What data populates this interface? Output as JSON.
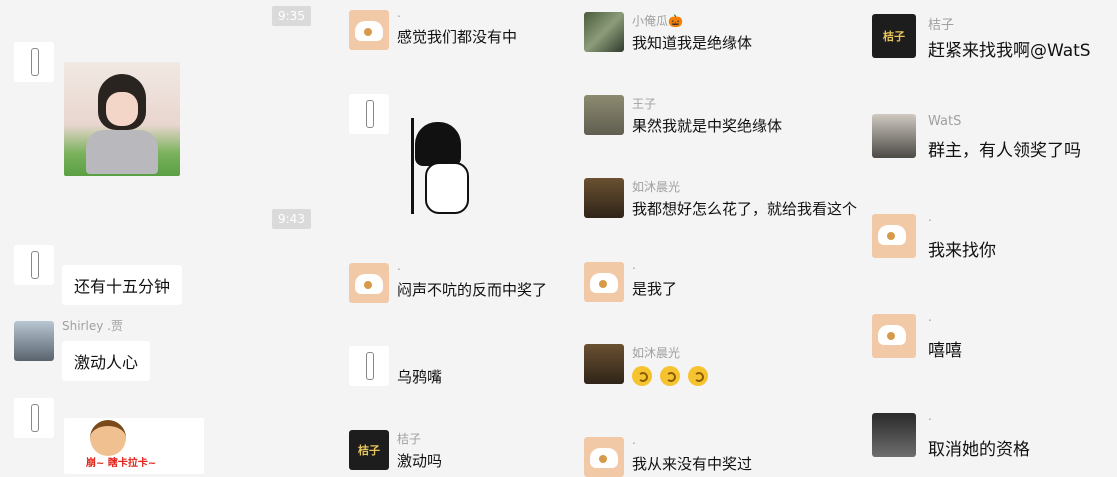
{
  "timestamps": [
    "9:35",
    "9:43"
  ],
  "col1": {
    "msg1": {
      "name": "",
      "sticker": "photo-sticker-girl"
    },
    "msg2": {
      "name": "",
      "text": "还有十五分钟"
    },
    "msg3": {
      "name": "Shirley .贾",
      "text": "激动人心"
    },
    "msg4": {
      "name": "",
      "sticker_text": "崩~ 瞎卡拉卡~"
    }
  },
  "col2": {
    "msg1": {
      "name": ".",
      "text": "感觉我们都没有中"
    },
    "msg2": {
      "name": "",
      "sticker": "peeking-cartoon"
    },
    "msg3": {
      "name": ".",
      "text": "闷声不吭的反而中奖了"
    },
    "msg4": {
      "name": "",
      "text": "乌鸦嘴"
    },
    "msg5": {
      "name": "桔子",
      "text": "激动吗"
    }
  },
  "col3": {
    "msg1": {
      "name": "小俺瓜🎃",
      "text": "我知道我是绝缘体"
    },
    "msg2": {
      "name": "王子",
      "text": "果然我就是中奖绝缘体"
    },
    "msg3": {
      "name": "如沐晨光",
      "text": "我都想好怎么花了，就给我看这个"
    },
    "msg4": {
      "name": ".",
      "text": "是我了"
    },
    "msg5": {
      "name": "如沐晨光",
      "emoji_count": 3
    },
    "msg6": {
      "name": ".",
      "text": "我从来没有中奖过"
    }
  },
  "col4": {
    "msg1": {
      "name": "桔子",
      "text": "赶紧来找我啊@WatS"
    },
    "msg2": {
      "name": "WatS",
      "text": "群主，有人领奖了吗"
    },
    "msg3": {
      "name": ".",
      "text": "我来找你"
    },
    "msg4": {
      "name": ".",
      "text": "嘻嘻"
    },
    "msg5": {
      "name": ".",
      "text": "取消她的资格"
    }
  },
  "avatar_labels": {
    "juzi": "桔子"
  },
  "colors": {
    "background": "#f4f4f4",
    "bubble": "#ffffff",
    "timestamp": "#dadada"
  }
}
